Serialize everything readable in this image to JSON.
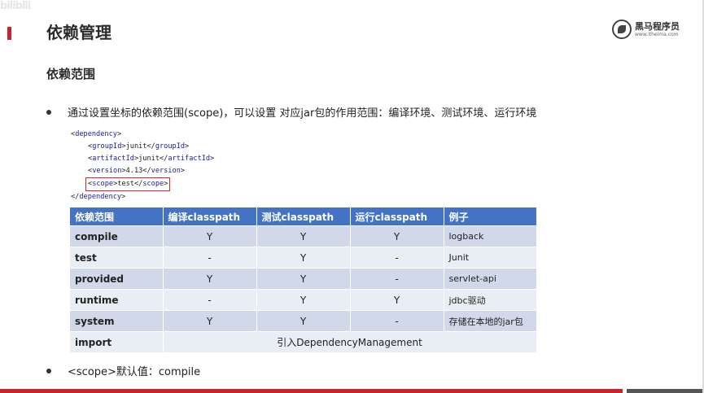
{
  "watermark": "bilibili",
  "title": "依赖管理",
  "logo": {
    "cn": "黑马程序员",
    "en": "www.itheima.com"
  },
  "subtitle": "依赖范围",
  "bullet1": "通过设置坐标的依赖范围(scope)，可以设置 对应jar包的作用范围：编译环境、测试环境、运行环境",
  "code": {
    "dep_open": "dependency",
    "group_tag": "groupId",
    "group_val": "junit",
    "artifact_tag": "artifactId",
    "artifact_val": "junit",
    "version_tag": "version",
    "version_val": "4.13",
    "scope_tag": "scope",
    "scope_val": "test",
    "dep_close": "dependency"
  },
  "table": {
    "headers": [
      "依赖范围",
      "编译classpath",
      "测试classpath",
      "运行classpath",
      "例子"
    ],
    "rows": [
      [
        "compile",
        "Y",
        "Y",
        "Y",
        "logback"
      ],
      [
        "test",
        "-",
        "Y",
        "-",
        "Junit"
      ],
      [
        "provided",
        "Y",
        "Y",
        "-",
        "servlet-api"
      ],
      [
        "runtime",
        "-",
        "Y",
        "Y",
        "jdbc驱动"
      ],
      [
        "system",
        "Y",
        "Y",
        "-",
        "存储在本地的jar包"
      ]
    ],
    "import_row": {
      "name": "import",
      "merged": "引入DependencyManagement"
    }
  },
  "bullet2": "<scope>默认值：compile",
  "colors": {
    "accent_red": "#c8222a",
    "header_blue": "#4472c4",
    "row_odd": "#d0d8e9",
    "row_even": "#e9edf4",
    "highlight": "#d9232e"
  }
}
